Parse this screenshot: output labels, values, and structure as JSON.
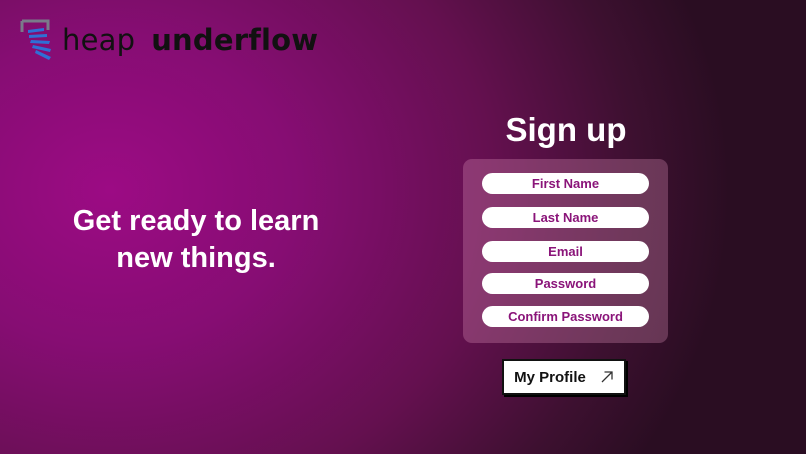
{
  "brand": {
    "name_light": "heap",
    "name_bold": "underflow",
    "logo_icon": "stacked-bars-logo-icon"
  },
  "hero": {
    "tagline_line1": "Get ready to learn",
    "tagline_line2": "new things."
  },
  "signup": {
    "title": "Sign up",
    "fields": [
      {
        "placeholder": "First Name"
      },
      {
        "placeholder": "Last Name"
      },
      {
        "placeholder": "Email"
      },
      {
        "placeholder": "Password"
      },
      {
        "placeholder": "Confirm Password"
      }
    ],
    "profile_button_label": "My Profile",
    "profile_button_icon": "arrow-up-right-icon"
  },
  "colors": {
    "background_accent": "#9c0b84",
    "field_text": "#8a1479",
    "logo_blue": "#2f6fd6"
  }
}
